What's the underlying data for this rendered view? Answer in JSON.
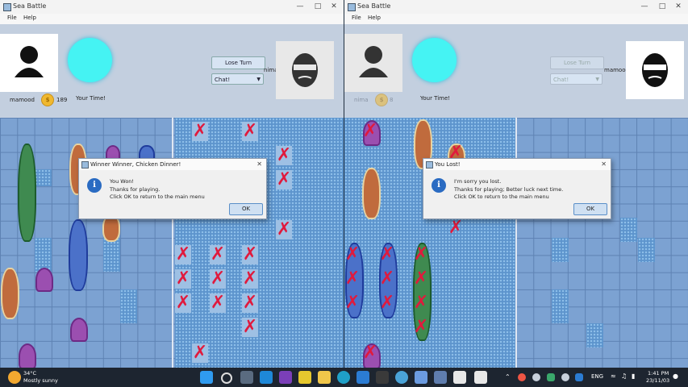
{
  "left_window": {
    "title": "Sea Battle",
    "menu": [
      "File",
      "Help"
    ],
    "player_name": "mamood",
    "coins": "189",
    "turn_label": "Your Time!",
    "lose_turn_label": "Lose Turn",
    "chat_label": "Chat!",
    "opponent_name": "nima",
    "dialog": {
      "title": "Winner Winner, Chicken Dinner!",
      "lines": [
        "You Won!",
        "Thanks for playing.",
        "Click OK to return to the main menu"
      ],
      "ok": "OK"
    }
  },
  "right_window": {
    "title": "Sea Battle",
    "menu": [
      "File",
      "Help"
    ],
    "player_name": "nima",
    "coins": "8",
    "turn_label": "Your Time!",
    "lose_turn_label": "Lose Turn",
    "chat_label": "Chat!",
    "opponent_name": "mamood",
    "dialog": {
      "title": "You Lost!",
      "lines": [
        "I'm sorry you lost.",
        "Thanks for playing; Better luck next time.",
        "Click OK to return to the main menu"
      ],
      "ok": "OK"
    }
  },
  "taskbar": {
    "weather_temp": "34°C",
    "weather_desc": "Mostly sunny",
    "language": "ENG",
    "time": "1:41 PM",
    "date": "23/11/03"
  },
  "colors": {
    "timer": "#45f3f3",
    "hit_mark": "#e01a3d",
    "grid": "#7ca2d2"
  }
}
